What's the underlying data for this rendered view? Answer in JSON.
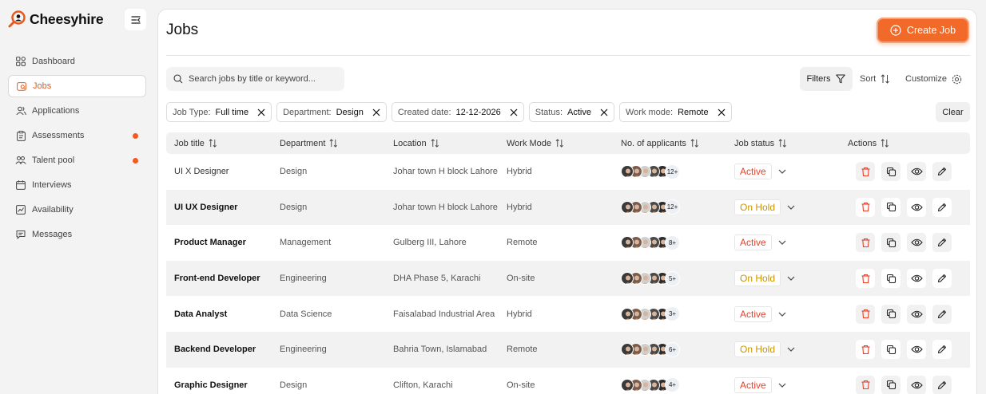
{
  "brand": {
    "name": "Cheesyhire"
  },
  "sidebar": {
    "items": [
      {
        "label": "Dashboard",
        "icon": "grid-icon",
        "active": false,
        "dot": false
      },
      {
        "label": "Jobs",
        "icon": "jobs-icon",
        "active": true,
        "dot": false
      },
      {
        "label": "Applications",
        "icon": "users-icon",
        "active": false,
        "dot": false
      },
      {
        "label": "Assessments",
        "icon": "clipboard-icon",
        "active": false,
        "dot": true
      },
      {
        "label": "Talent pool",
        "icon": "group-icon",
        "active": false,
        "dot": true
      },
      {
        "label": "Interviews",
        "icon": "calendar-icon",
        "active": false,
        "dot": false
      },
      {
        "label": "Availability",
        "icon": "chart-icon",
        "active": false,
        "dot": false
      },
      {
        "label": "Messages",
        "icon": "message-icon",
        "active": false,
        "dot": false
      }
    ]
  },
  "page": {
    "title": "Jobs",
    "create_label": "Create Job"
  },
  "toolbar": {
    "search_placeholder": "Search jobs by title or keyword...",
    "filters_label": "Filters",
    "sort_label": "Sort",
    "customize_label": "Customize",
    "clear_label": "Clear"
  },
  "filters": [
    {
      "key": "Job Type:",
      "value": "Full time"
    },
    {
      "key": "Department:",
      "value": "Design"
    },
    {
      "key": "Created date:",
      "value": "12-12-2026"
    },
    {
      "key": "Status:",
      "value": "Active"
    },
    {
      "key": "Work mode:",
      "value": "Remote"
    }
  ],
  "table": {
    "columns": [
      "Job title",
      "Department",
      "Location",
      "Work Mode",
      "No. of applicants",
      "Job status",
      "Actions"
    ],
    "rows": [
      {
        "title": "UI X Designer",
        "department": "Design",
        "location": "Johar town H block Lahore",
        "mode": "Hybrid",
        "applicants": "12+",
        "status": "Active"
      },
      {
        "title": "UI UX Designer",
        "department": "Design",
        "location": "Johar town H block Lahore",
        "mode": "Hybrid",
        "applicants": "12+",
        "status": "On Hold"
      },
      {
        "title": "Product Manager",
        "department": "Management",
        "location": "Gulberg III, Lahore",
        "mode": "Remote",
        "applicants": "8+",
        "status": "Active"
      },
      {
        "title": "Front-end Developer",
        "department": "Engineering",
        "location": "DHA Phase 5, Karachi",
        "mode": "On-site",
        "applicants": "5+",
        "status": "On Hold"
      },
      {
        "title": "Data Analyst",
        "department": "Data Science",
        "location": "Faisalabad Industrial Area",
        "mode": "Hybrid",
        "applicants": "3+",
        "status": "Active"
      },
      {
        "title": "Backend Developer",
        "department": "Engineering",
        "location": "Bahria Town, Islamabad",
        "mode": "Remote",
        "applicants": "6+",
        "status": "On Hold"
      },
      {
        "title": "Graphic Designer",
        "department": "Design",
        "location": "Clifton, Karachi",
        "mode": "On-site",
        "applicants": "4+",
        "status": "Active"
      }
    ]
  },
  "colors": {
    "accent": "#f26a2a",
    "active_status": "#e8412a",
    "hold_status": "#c99400"
  }
}
